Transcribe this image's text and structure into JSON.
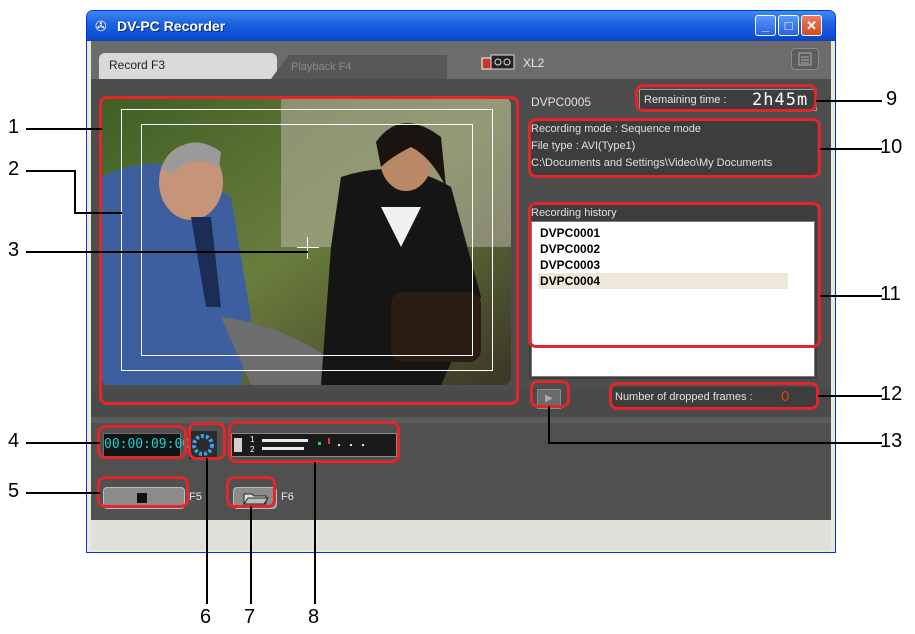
{
  "window": {
    "title": "DV-PC Recorder"
  },
  "tabs": [
    {
      "label": "Record F3",
      "active": true
    },
    {
      "label": "Playback F4",
      "active": false
    }
  ],
  "device": {
    "label": "XL2",
    "icon": "camcorder-icon"
  },
  "file_name": "DVPC0005",
  "remaining_time": {
    "label": "Remaining time :",
    "value": "2h45m"
  },
  "info": {
    "mode": "Recording mode : Sequence mode",
    "type": "File type : AVI(Type1)",
    "path": "C:\\Documents and Settings\\Video\\My Documents"
  },
  "history": {
    "label": "Recording history",
    "items": [
      "DVPC0001",
      "DVPC0002",
      "DVPC0003",
      "DVPC0004"
    ],
    "selected_index": 3
  },
  "dropped_frames": {
    "label": "Number of dropped frames :",
    "value": "0"
  },
  "timecode": "00:00:09:00",
  "audio_channels": [
    "1",
    "2"
  ],
  "stop_key": "F5",
  "folder_key": "F6",
  "callouts": [
    "1",
    "2",
    "3",
    "4",
    "5",
    "6",
    "7",
    "8",
    "9",
    "10",
    "11",
    "12",
    "13"
  ],
  "colors": {
    "highlight": "#e3262a",
    "timecode": "#1fd3cb",
    "dropped": "#e0401a"
  }
}
